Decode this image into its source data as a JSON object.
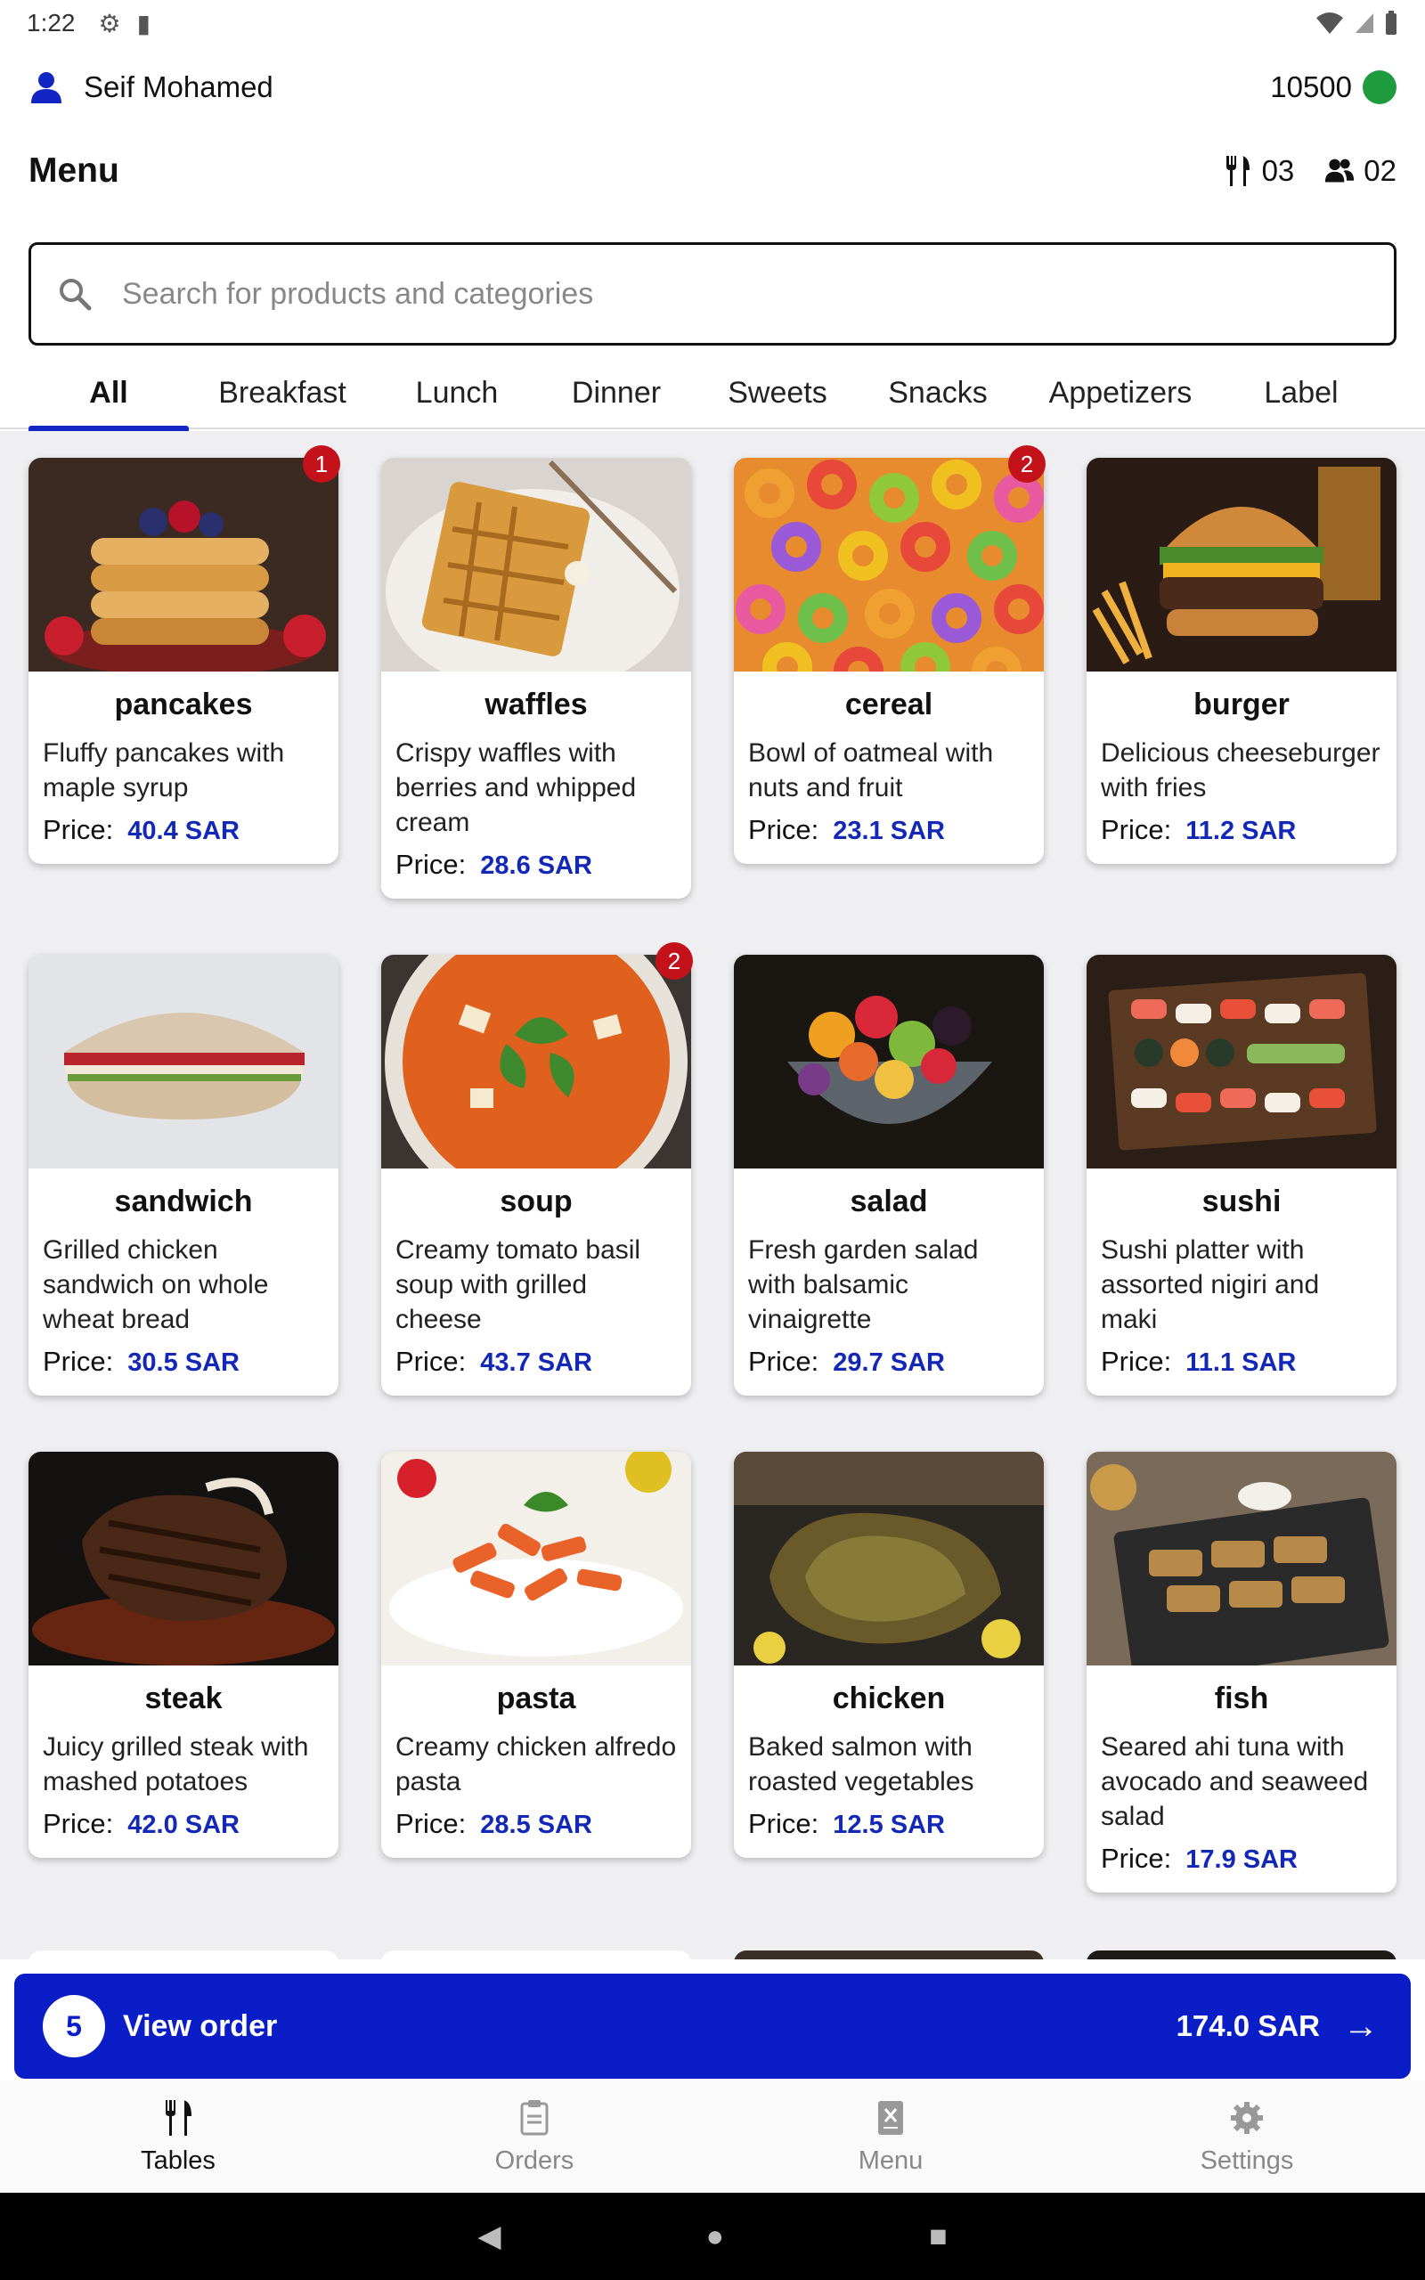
{
  "status_bar": {
    "time": "1:22"
  },
  "user": {
    "name": "Seif Mohamed",
    "balance": "10500"
  },
  "header": {
    "title": "Menu",
    "tables_count": "03",
    "guests_count": "02"
  },
  "search": {
    "placeholder": "Search for products and categories"
  },
  "tabs": [
    "All",
    "Breakfast",
    "Lunch",
    "Dinner",
    "Sweets",
    "Snacks",
    "Appetizers",
    "Label"
  ],
  "active_tab": "All",
  "price_label": "Price:",
  "products": [
    {
      "name": "pancakes",
      "description": "Fluffy pancakes with maple syrup",
      "price": "40.4 SAR",
      "badge": "1"
    },
    {
      "name": "waffles",
      "description": "Crispy waffles with berries and whipped cream",
      "price": "28.6 SAR",
      "badge": ""
    },
    {
      "name": "cereal",
      "description": "Bowl of oatmeal with nuts and fruit",
      "price": "23.1 SAR",
      "badge": "2"
    },
    {
      "name": "burger",
      "description": "Delicious cheeseburger with fries",
      "price": "11.2 SAR",
      "badge": ""
    },
    {
      "name": "sandwich",
      "description": "Grilled chicken sandwich on whole wheat bread",
      "price": "30.5 SAR",
      "badge": ""
    },
    {
      "name": "soup",
      "description": "Creamy tomato basil soup with grilled cheese",
      "price": "43.7 SAR",
      "badge": "2"
    },
    {
      "name": "salad",
      "description": "Fresh garden salad with balsamic vinaigrette",
      "price": "29.7 SAR",
      "badge": ""
    },
    {
      "name": "sushi",
      "description": "Sushi platter with assorted nigiri and maki",
      "price": "11.1 SAR",
      "badge": ""
    },
    {
      "name": "steak",
      "description": "Juicy grilled steak with mashed potatoes",
      "price": "42.0 SAR",
      "badge": ""
    },
    {
      "name": "pasta",
      "description": "Creamy chicken alfredo pasta",
      "price": "28.5 SAR",
      "badge": ""
    },
    {
      "name": "chicken",
      "description": "Baked salmon with roasted vegetables",
      "price": "12.5 SAR",
      "badge": ""
    },
    {
      "name": "fish",
      "description": "Seared ahi tuna with avocado and seaweed salad",
      "price": "17.9 SAR",
      "badge": ""
    }
  ],
  "order_bar": {
    "count": "5",
    "label": "View order",
    "total": "174.0 SAR"
  },
  "bottom_nav": [
    {
      "label": "Tables",
      "icon": "cutlery-icon",
      "active": true
    },
    {
      "label": "Orders",
      "icon": "clipboard-icon",
      "active": false
    },
    {
      "label": "Menu",
      "icon": "menu-book-icon",
      "active": false
    },
    {
      "label": "Settings",
      "icon": "gear-icon",
      "active": false
    }
  ],
  "colors": {
    "accent": "#0b1dc6",
    "price": "#1428b8",
    "badge": "#c4121b",
    "online": "#1e9b3c"
  }
}
